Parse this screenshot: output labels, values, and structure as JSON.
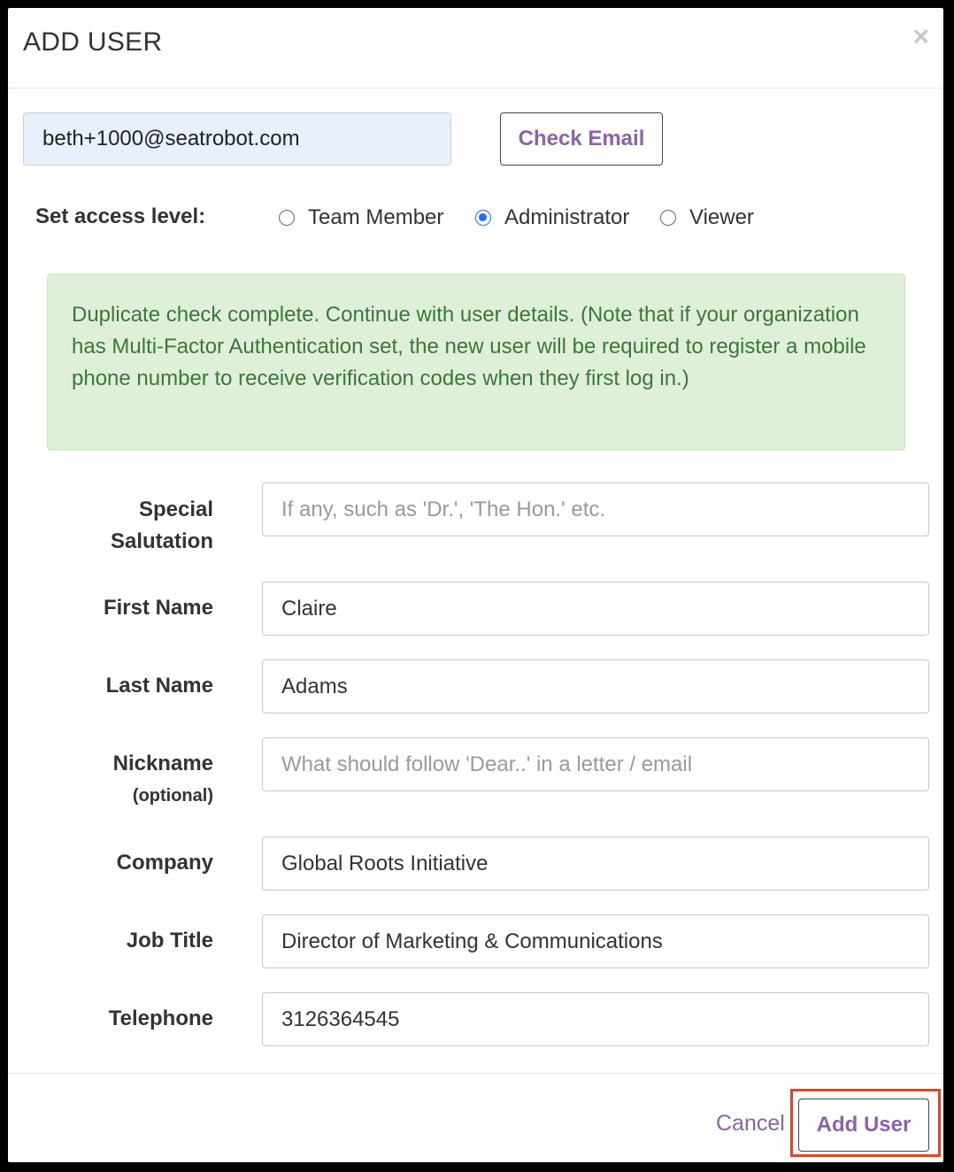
{
  "modal": {
    "title": "ADD USER",
    "close_glyph": "×"
  },
  "email": {
    "value": "beth+1000@seatrobot.com",
    "check_button": "Check Email"
  },
  "access": {
    "label": "Set access level:",
    "options": [
      {
        "label": "Team Member",
        "selected": false
      },
      {
        "label": "Administrator",
        "selected": true
      },
      {
        "label": "Viewer",
        "selected": false
      }
    ]
  },
  "alert": {
    "text": "Duplicate check complete. Continue with user details. (Note that if your organization has Multi-Factor Authentication set, the new user will be required to register a mobile phone number to receive verification codes when they first log in.)"
  },
  "fields": {
    "salutation": {
      "label_line1": "Special",
      "label_line2": "Salutation",
      "value": "",
      "placeholder": "If any, such as 'Dr.', 'The Hon.' etc."
    },
    "first_name": {
      "label": "First Name",
      "value": "Claire",
      "placeholder": ""
    },
    "last_name": {
      "label": "Last Name",
      "value": "Adams",
      "placeholder": ""
    },
    "nickname": {
      "label": "Nickname",
      "sublabel": "(optional)",
      "value": "",
      "placeholder": "What should follow 'Dear..' in a letter / email"
    },
    "company": {
      "label": "Company",
      "value": "Global Roots Initiative",
      "placeholder": ""
    },
    "job_title": {
      "label": "Job Title",
      "value": "Director of Marketing & Communications",
      "placeholder": ""
    },
    "telephone": {
      "label": "Telephone",
      "value": "3126364545",
      "placeholder": ""
    }
  },
  "footer": {
    "cancel": "Cancel",
    "add_user": "Add User"
  },
  "colors": {
    "accent": "#8a63a8",
    "alert_bg": "#dff0d8",
    "alert_text": "#3c763d",
    "highlight": "#e0452b",
    "radio_selected": "#1a73e8"
  }
}
